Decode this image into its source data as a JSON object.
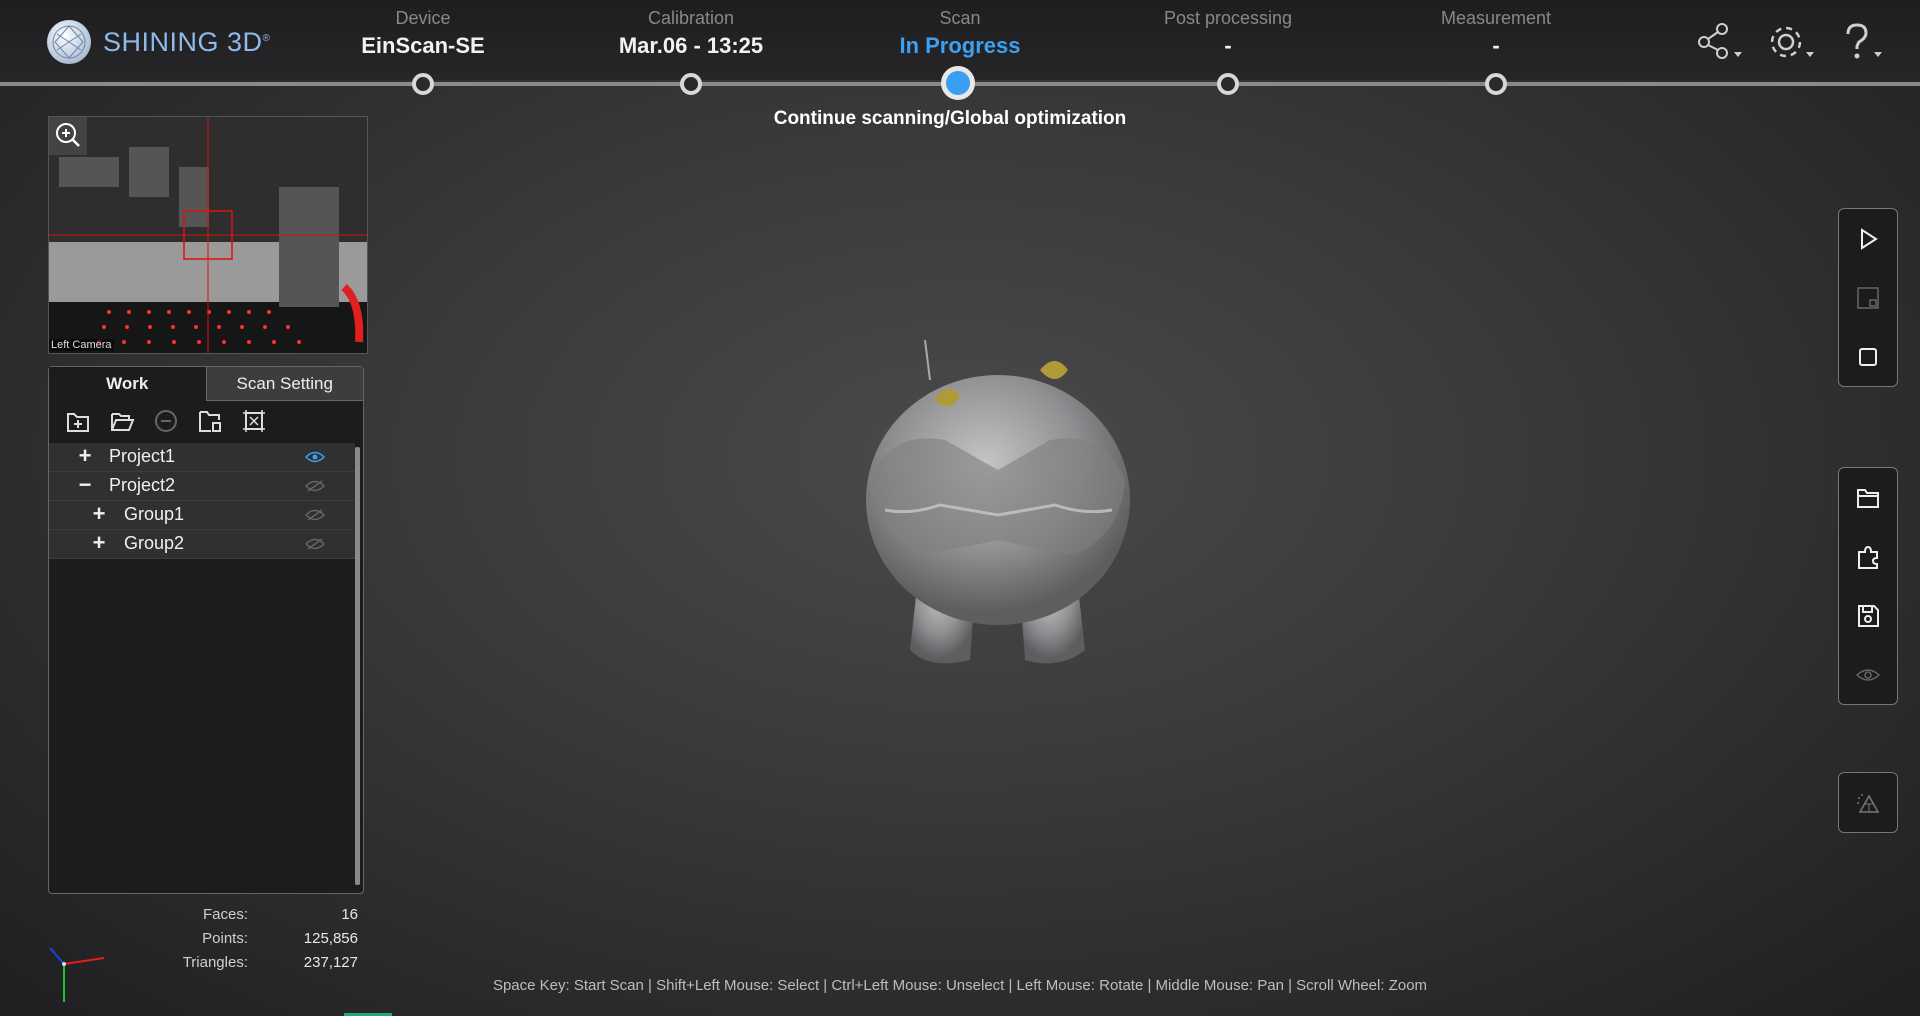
{
  "app": {
    "brand": "SHINING 3D",
    "registered_mark": "®"
  },
  "workflow": {
    "steps": [
      {
        "name": "Device",
        "value": "EinScan-SE"
      },
      {
        "name": "Calibration",
        "value": "Mar.06 - 13:25"
      },
      {
        "name": "Scan",
        "value": "In Progress"
      },
      {
        "name": "Post processing",
        "value": "-"
      },
      {
        "name": "Measurement",
        "value": "-"
      }
    ],
    "active_step": "Scan",
    "status": "Continue scanning/Global optimization"
  },
  "header_icons": [
    "share-icon",
    "settings-icon",
    "help-icon"
  ],
  "camera": {
    "label": "Left Camera"
  },
  "panel": {
    "tabs": [
      "Work",
      "Scan Setting"
    ],
    "active_tab": "Work",
    "toolbar": [
      "new-project-icon",
      "open-project-icon",
      "remove-icon",
      "delete-folder-icon",
      "merge-icon"
    ],
    "tree": [
      {
        "toggle": "+",
        "label": "Project1",
        "visible": true
      },
      {
        "toggle": "−",
        "label": "Project2",
        "visible": false
      },
      {
        "toggle": "+",
        "label": "Group1",
        "visible": false
      },
      {
        "toggle": "+",
        "label": "Group2",
        "visible": false
      }
    ]
  },
  "stats": [
    {
      "label": "Faces:",
      "value": "16"
    },
    {
      "label": "Points:",
      "value": "125,856"
    },
    {
      "label": "Triangles:",
      "value": "237,127"
    }
  ],
  "hint": "Space Key: Start Scan | Shift+Left Mouse: Select | Ctrl+Left Mouse: Unselect | Left Mouse: Rotate | Middle Mouse: Pan | Scroll Wheel: Zoom",
  "right_toolbar": {
    "group1": [
      "play-icon",
      "crop-icon",
      "stop-icon"
    ],
    "group2": [
      "folder-icon",
      "puzzle-icon",
      "save-icon",
      "eye-icon"
    ],
    "group3": [
      "mesh-icon"
    ]
  },
  "colors": {
    "accent": "#3a9ff2",
    "background": "#3a3a3c",
    "panel": "#1c1c1d"
  }
}
